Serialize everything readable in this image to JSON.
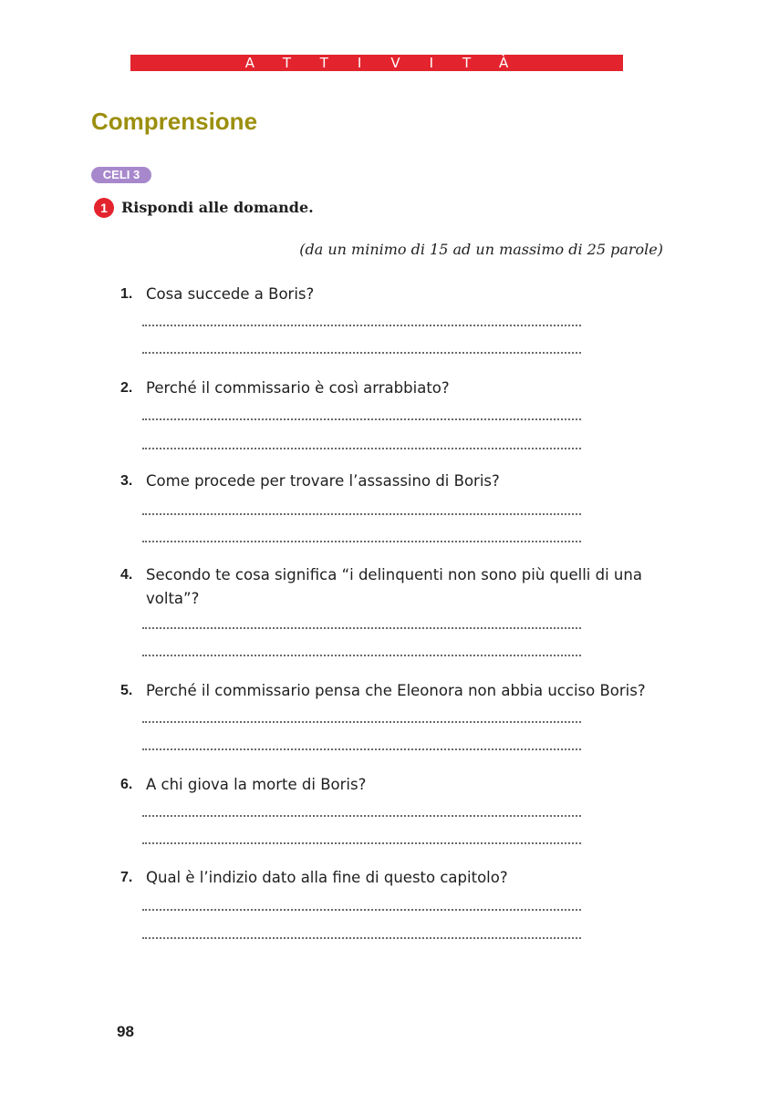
{
  "banner": {
    "label": "ATTIVITÀ"
  },
  "section": {
    "title": "Comprensione"
  },
  "badge": {
    "label": "CELI 3"
  },
  "exercise": {
    "number": "1",
    "instruction": "Rispondi alle domande.",
    "note": "(da un minimo di 15 ad un massimo di 25 parole)"
  },
  "questions": [
    {
      "num": "1.",
      "text": "Cosa succede a Boris?"
    },
    {
      "num": "2.",
      "text": "Perché il commissario è così arrabbiato?"
    },
    {
      "num": "3.",
      "text": "Come procede per trovare l’assassino di Boris?"
    },
    {
      "num": "4.",
      "text": "Secondo te cosa significa “i delinquenti non sono più quelli di una volta”?"
    },
    {
      "num": "5.",
      "text": "Perché il commissario pensa che Eleonora non abbia ucciso Boris?"
    },
    {
      "num": "6.",
      "text": "A chi giova la morte di Boris?"
    },
    {
      "num": "7.",
      "text": "Qual è l’indizio dato alla fine di questo capitolo?"
    }
  ],
  "page_number": "98",
  "colors": {
    "banner": "#e3242e",
    "title": "#9c8f0e",
    "badge": "#a888cc",
    "exercise_number": "#e3242e"
  }
}
